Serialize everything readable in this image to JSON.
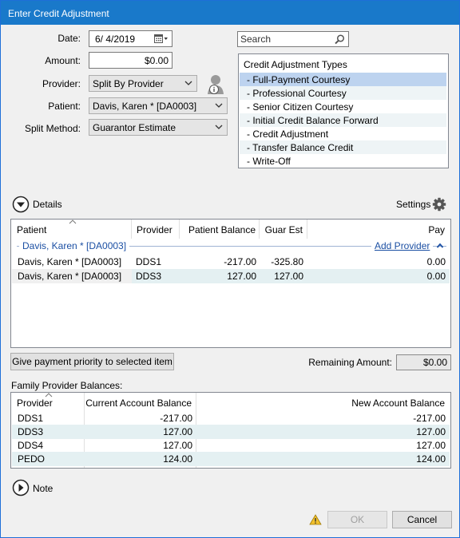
{
  "window": {
    "title": "Enter Credit Adjustment"
  },
  "form": {
    "date_label": "Date:",
    "date_value": "6/ 4/2019",
    "amount_label": "Amount:",
    "amount_value": "$0.00",
    "provider_label": "Provider:",
    "provider_value": "Split By Provider",
    "patient_label": "Patient:",
    "patient_value": "Davis, Karen *  [DA0003]",
    "split_label": "Split Method:",
    "split_value": "Guarantor Estimate"
  },
  "search": {
    "placeholder": "Search"
  },
  "types": {
    "header": "Credit Adjustment Types",
    "items": [
      "- Full-Payment Courtesy",
      "- Professional Courtesy",
      "- Senior Citizen Courtesy",
      "- Initial Credit Balance Forward",
      "- Credit Adjustment",
      "- Transfer Balance Credit",
      "- Write-Off"
    ],
    "selected_index": 0
  },
  "details": {
    "toggle_label": "Details",
    "settings_label": "Settings",
    "columns": [
      "Patient",
      "Provider",
      "Patient Balance",
      "Guar Est",
      "Pay"
    ],
    "group_label": "Davis, Karen *  [DA0003]",
    "add_provider": "Add Provider",
    "rows": [
      {
        "patient": "Davis, Karen *  [DA0003]",
        "provider": "DDS1",
        "balance": "-217.00",
        "guar": "-325.80",
        "pay": "0.00"
      },
      {
        "patient": "Davis, Karen *  [DA0003]",
        "provider": "DDS3",
        "balance": "127.00",
        "guar": "127.00",
        "pay": "0.00"
      }
    ]
  },
  "priority_button": "Give payment priority to selected item",
  "remaining": {
    "label": "Remaining Amount:",
    "value": "$0.00"
  },
  "family": {
    "label": "Family Provider Balances:",
    "columns": [
      "Provider",
      "Current Account Balance",
      "New Account Balance"
    ],
    "rows": [
      {
        "provider": "DDS1",
        "current": "-217.00",
        "new": "-217.00"
      },
      {
        "provider": "DDS3",
        "current": "127.00",
        "new": "127.00"
      },
      {
        "provider": "DDS4",
        "current": "127.00",
        "new": "127.00"
      },
      {
        "provider": "PEDO",
        "current": "124.00",
        "new": "124.00"
      }
    ]
  },
  "note": {
    "toggle_label": "Note"
  },
  "footer": {
    "ok_label": "OK",
    "cancel_label": "Cancel"
  },
  "colors": {
    "title_bar": "#1979ca",
    "selection": "#bdd3ef",
    "link": "#1b4fa3"
  },
  "icons": [
    "calendar-icon",
    "search-icon",
    "patient-info-icon",
    "expand-icon",
    "gear-icon",
    "warning-icon"
  ]
}
